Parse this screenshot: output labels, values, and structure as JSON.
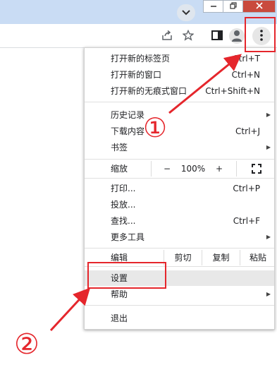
{
  "menu": {
    "new_tab": "打开新的标签页",
    "new_tab_shortcut": "Ctrl+T",
    "new_window": "打开新的窗口",
    "new_window_shortcut": "Ctrl+N",
    "incognito": "打开新的无痕式窗口",
    "incognito_shortcut": "Ctrl+Shift+N",
    "history": "历史记录",
    "downloads": "下载内容",
    "downloads_shortcut": "Ctrl+J",
    "bookmarks": "书签",
    "zoom_label": "缩放",
    "zoom_minus": "−",
    "zoom_value": "100%",
    "zoom_plus": "+",
    "print": "打印...",
    "print_shortcut": "Ctrl+P",
    "cast": "投放...",
    "find": "查找...",
    "find_shortcut": "Ctrl+F",
    "more_tools": "更多工具",
    "edit_label": "编辑",
    "cut": "剪切",
    "copy": "复制",
    "paste": "粘贴",
    "settings": "设置",
    "help": "帮助",
    "exit": "退出"
  },
  "annotations": {
    "step1": "①",
    "step2": "②",
    "color": "#e5262c"
  },
  "icons": {
    "tab_search": "chevron-down-icon",
    "minimize": "minimize-icon",
    "restore": "restore-icon",
    "close": "close-icon",
    "share": "share-icon",
    "bookmark": "star-icon",
    "side_panel": "side-panel-icon",
    "profile": "profile-icon",
    "menu": "kebab-menu-icon"
  }
}
